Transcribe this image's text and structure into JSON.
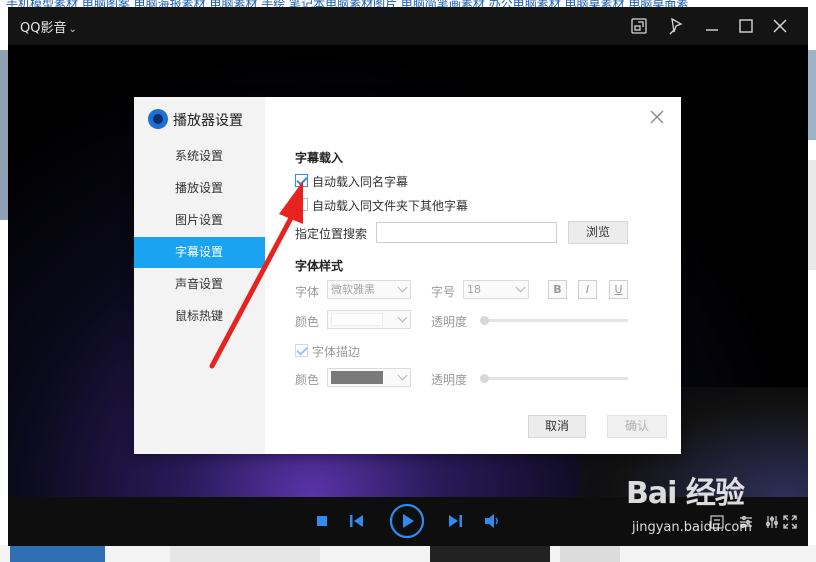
{
  "background_page": {
    "link_strip_text": "手机模型素材 电脑图案 电脑海报素材 电脑素材 手绘 笔记本电脑素材图片 电脑简笔画素材 办公电脑素材 电脑桌素材 电脑桌面素"
  },
  "window": {
    "title": "QQ影音",
    "title_caret": "⌄",
    "controls": [
      "pip-icon",
      "pin-icon",
      "minimize-icon",
      "maximize-icon",
      "close-icon"
    ]
  },
  "dialog": {
    "title": "播放器设置",
    "nav": [
      {
        "label": "系统设置",
        "active": false
      },
      {
        "label": "播放设置",
        "active": false
      },
      {
        "label": "图片设置",
        "active": false
      },
      {
        "label": "字幕设置",
        "active": true
      },
      {
        "label": "声音设置",
        "active": false
      },
      {
        "label": "鼠标热键",
        "active": false
      }
    ],
    "subtitle_load": {
      "heading": "字幕载入",
      "auto_load_same_name": {
        "label": "自动载入同名字幕",
        "checked": true
      },
      "auto_load_folder": {
        "label": "自动载入同文件夹下其他字幕",
        "checked": false
      },
      "search_location_label": "指定位置搜索",
      "search_location_value": "",
      "browse_label": "浏览"
    },
    "font_style": {
      "heading": "字体样式",
      "font_label": "字体",
      "font_value": "微软雅黑",
      "size_label": "字号",
      "size_value": "18",
      "bold_label": "B",
      "italic_label": "I",
      "underline_label": "U",
      "color_label": "颜色",
      "color_value": "#ffffff",
      "opacity_label": "透明度",
      "opacity_value": 0,
      "outline": {
        "label": "字体描边",
        "checked": true
      },
      "outline_color_label": "颜色",
      "outline_color_value": "#7a7a7a",
      "outline_opacity_label": "透明度",
      "outline_opacity_value": 0
    },
    "cancel_label": "取消",
    "confirm_label": "确认"
  },
  "watermark": {
    "brand": "Bai  经验",
    "site": "jingyan.baidu.com"
  },
  "colors": {
    "accent": "#1aa3f0",
    "player_blue": "#2f8bf0",
    "annotation_red": "#e8231f"
  }
}
